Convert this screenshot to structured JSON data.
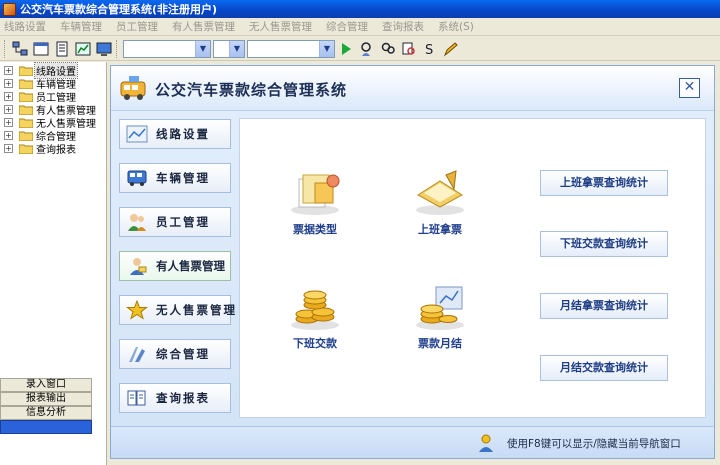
{
  "window": {
    "title": "公交汽车票款综合管理系统(非注册用户)"
  },
  "menu": [
    "线路设置",
    "车辆管理",
    "员工管理",
    "有人售票管理",
    "无人售票管理",
    "综合管理",
    "查询报表",
    "系统(S)"
  ],
  "toolbar": {
    "buttons": [
      "network-icon",
      "window-icon",
      "document-icon",
      "chart-icon",
      "monitor-icon"
    ],
    "combos": [
      "",
      "",
      ""
    ],
    "actions": [
      "play-icon",
      "search-user-icon",
      "search-group-icon",
      "find-icon",
      "money-icon",
      "edit-pencil-icon"
    ]
  },
  "tree": [
    {
      "label": "线路设置",
      "selected": true
    },
    {
      "label": "车辆管理"
    },
    {
      "label": "员工管理"
    },
    {
      "label": "有人售票管理"
    },
    {
      "label": "无人售票管理"
    },
    {
      "label": "综合管理"
    },
    {
      "label": "查询报表"
    }
  ],
  "left_nav": [
    "录入窗口",
    "报表输出",
    "信息分析"
  ],
  "dialog": {
    "title": "公交汽车票款综合管理系统",
    "side_buttons": [
      {
        "label": "线路设置",
        "icon": "route-icon"
      },
      {
        "label": "车辆管理",
        "icon": "bus-icon"
      },
      {
        "label": "员工管理",
        "icon": "staff-icon"
      },
      {
        "label": "有人售票管理",
        "icon": "conductor-icon",
        "active": true
      },
      {
        "label": "无人售票管理",
        "icon": "star-icon"
      },
      {
        "label": "综合管理",
        "icon": "integrated-icon"
      },
      {
        "label": "查询报表",
        "icon": "report-icon"
      }
    ],
    "features": [
      {
        "label": "票据类型",
        "icon": "ticket-type-icon"
      },
      {
        "label": "上班拿票",
        "icon": "take-ticket-icon"
      },
      {
        "label": "下班交款",
        "icon": "coins-icon"
      },
      {
        "label": "票款月结",
        "icon": "monthly-settle-icon"
      }
    ],
    "query_buttons": [
      "上班拿票查询统计",
      "下班交款查询统计",
      "月结拿票查询统计",
      "月结交款查询统计"
    ],
    "footer_hint": "使用F8键可以显示/隐藏当前导航窗口"
  }
}
